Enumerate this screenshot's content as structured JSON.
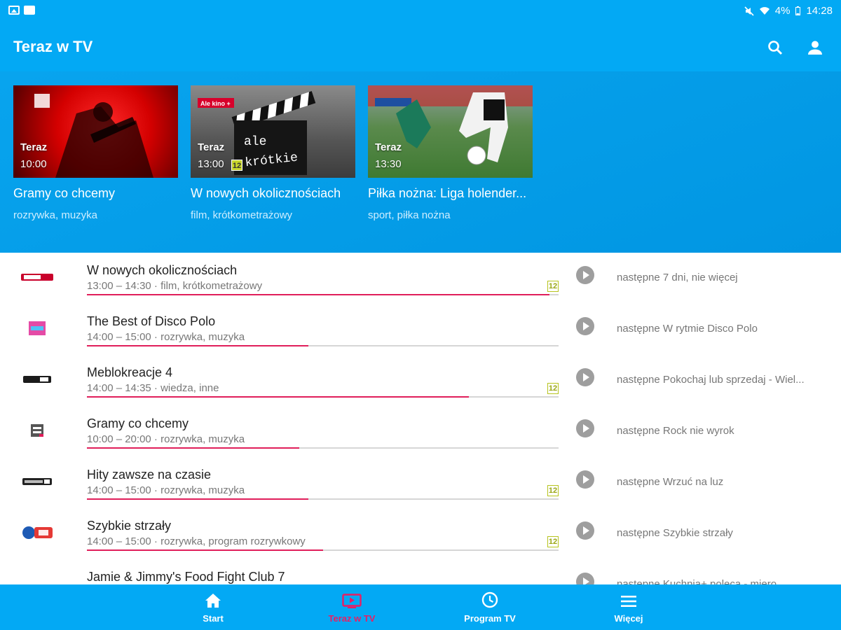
{
  "status_bar": {
    "battery": "4%",
    "time": "14:28"
  },
  "app_bar": {
    "title": "Teraz w TV"
  },
  "featured": [
    {
      "now_label": "Teraz",
      "time": "10:00",
      "age": "",
      "title": "Gramy co chcemy",
      "genre": "rozrywka, muzyka"
    },
    {
      "now_label": "Teraz",
      "time": "13:00",
      "age": "12",
      "title": "W nowych okolicznościach",
      "genre": "film, krótkometrażowy",
      "thumb_text_1": "ale",
      "thumb_text_2": "krótkie",
      "thumb_badge": "Ale kino +"
    },
    {
      "now_label": "Teraz",
      "time": "13:30",
      "age": "",
      "title": "Piłka nożna: Liga holender...",
      "genre": "sport, piłka nożna"
    }
  ],
  "programs": [
    {
      "title": "W nowych okolicznościach",
      "subtitle": "13:00 – 14:30 · film, krótkometrażowy",
      "age": "12",
      "progress": 0.98,
      "next": "następne 7 dni, nie więcej",
      "logo": "ale-kino-logo"
    },
    {
      "title": "The Best of Disco Polo",
      "subtitle": "14:00 – 15:00 · rozrywka, muzyka",
      "age": "",
      "progress": 0.47,
      "next": "następne W rytmie Disco Polo",
      "logo": "disco-polo-logo"
    },
    {
      "title": "Meblokreacje 4",
      "subtitle": "14:00 – 14:35 · wiedza, inne",
      "age": "12",
      "progress": 0.81,
      "next": "następne Pokochaj lub sprzedaj - Wiel...",
      "logo": "channel-logo"
    },
    {
      "title": "Gramy co chcemy",
      "subtitle": "10:00 – 20:00 · rozrywka, muzyka",
      "age": "",
      "progress": 0.45,
      "next": "następne Rock nie wyrok",
      "logo": "music-channel-logo"
    },
    {
      "title": "Hity zawsze na czasie",
      "subtitle": "14:00 – 15:00 · rozrywka, muzyka",
      "age": "12",
      "progress": 0.47,
      "next": "następne Wrzuć na luz",
      "logo": "music-channel-logo"
    },
    {
      "title": "Szybkie strzały",
      "subtitle": "14:00 – 15:00 · rozrywka, program rozrywkowy",
      "age": "12",
      "progress": 0.5,
      "next": "następne Szybkie strzały",
      "logo": "tv-logo"
    },
    {
      "title": "Jamie & Jimmy's Food Fight Club 7",
      "subtitle": "",
      "age": "",
      "progress": 0,
      "next": "następne Kuchnia+ poleca - miero...",
      "logo": "kuchnia-logo"
    }
  ],
  "bottom_nav": [
    {
      "label": "Start",
      "icon": "home-icon"
    },
    {
      "label": "Teraz w TV",
      "icon": "tv-icon"
    },
    {
      "label": "Program TV",
      "icon": "clock-icon"
    },
    {
      "label": "Więcej",
      "icon": "menu-icon"
    }
  ],
  "colors": {
    "primary": "#03a9f4",
    "accent": "#e91e63",
    "age_badge": "#c6d42b"
  }
}
